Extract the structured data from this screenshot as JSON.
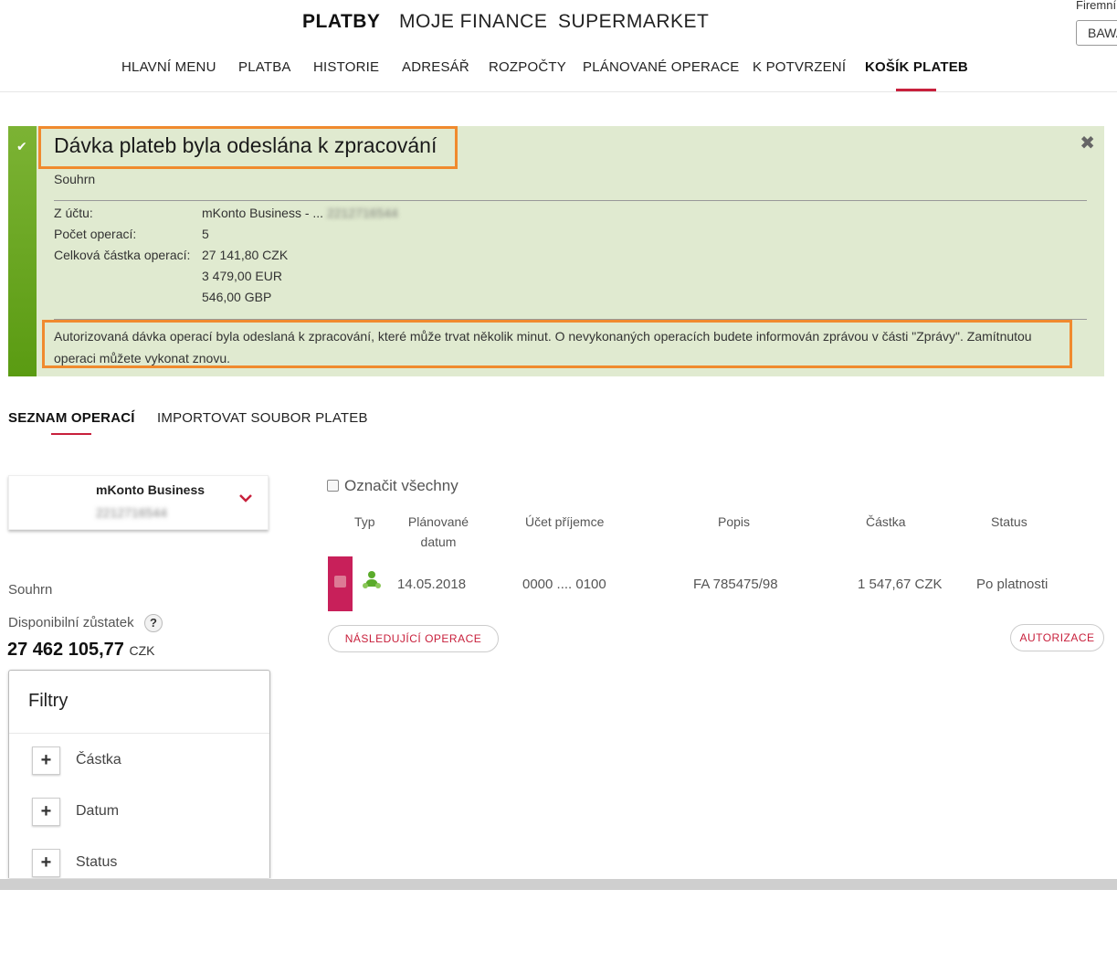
{
  "header": {
    "main_tabs": [
      {
        "label": "PLATBY",
        "active": true
      },
      {
        "label": "MOJE FINANCE",
        "active": false
      },
      {
        "label": "SUPERMARKET",
        "active": false
      }
    ],
    "sub_tabs": [
      {
        "label": "HLAVNÍ MENU"
      },
      {
        "label": "PLATBA"
      },
      {
        "label": "HISTORIE"
      },
      {
        "label": "ADRESÁŘ"
      },
      {
        "label": "ROZPOČTY"
      },
      {
        "label": "PLÁNOVANÉ OPERACE"
      },
      {
        "label": "K POTVRZENÍ"
      },
      {
        "label": "KOŠÍK PLATEB",
        "active": true
      }
    ],
    "company_label": "Firemní",
    "company_value": "BAWA"
  },
  "alert": {
    "title": "Dávka plateb byla odeslána k zpracování",
    "summary_label": "Souhrn",
    "from_account_label": "Z účtu:",
    "from_account_value": "mKonto Business - ...",
    "from_account_number": "2212716544",
    "count_label": "Počet operací:",
    "count_value": "5",
    "total_label": "Celková částka operací:",
    "totals": [
      "27 141,80 CZK",
      "3 479,00 EUR",
      "546,00 GBP"
    ],
    "message": "Autorizovaná dávka operací byla odeslaná k zpracování, které může trvat několik minut. O nevykonaných operacích budete informován zprávou v části \"Zprávy\". Zamítnutou operaci můžete vykonat znovu.",
    "close_icon": "close-icon",
    "status_icon": "check-icon",
    "accent_color": "#6aa71e"
  },
  "tabs": {
    "operations": "SEZNAM OPERACÍ",
    "import": "IMPORTOVAT SOUBOR PLATEB"
  },
  "account": {
    "name": "mKonto Business",
    "number": "2212716544"
  },
  "sidebar": {
    "summary": "Souhrn",
    "available_balance_label": "Disponibilní zůstatek",
    "help": "?",
    "balance": "27 462 105,77",
    "currency": "CZK"
  },
  "filters": {
    "title": "Filtry",
    "items": [
      {
        "label": "Částka"
      },
      {
        "label": "Datum"
      },
      {
        "label": "Status"
      }
    ]
  },
  "table": {
    "select_all": "Označit všechny",
    "columns": {
      "type": "Typ",
      "planned_line1": "Plánované",
      "planned_line2": "datum",
      "recipient": "Účet příjemce",
      "description": "Popis",
      "amount": "Částka",
      "status": "Status"
    },
    "rows": [
      {
        "type_icon": "person-payment-icon",
        "date": "14.05.2018",
        "recipient": "0000 .... 0100",
        "description": "FA 785475/98",
        "amount": "1 547,67 CZK",
        "status": "Po platnosti"
      }
    ],
    "next_button": "NÁSLEDUJÍCÍ OPERACE",
    "authorize_button": "AUTORIZACE"
  },
  "colors": {
    "brand": "#c8203c",
    "alert_bg": "#e0ead0",
    "highlight_border": "#f08a2e"
  }
}
